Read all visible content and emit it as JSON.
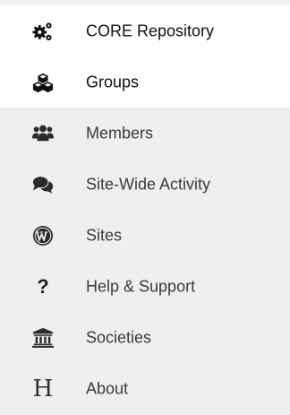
{
  "menu": {
    "items": [
      {
        "label": "CORE Repository",
        "icon": "gears-icon"
      },
      {
        "label": "Groups",
        "icon": "cubes-icon"
      },
      {
        "label": "Members",
        "icon": "users-icon"
      },
      {
        "label": "Site-Wide Activity",
        "icon": "comments-icon"
      },
      {
        "label": "Sites",
        "icon": "wordpress-icon"
      },
      {
        "label": "Help & Support",
        "icon": "question-icon"
      },
      {
        "label": "Societies",
        "icon": "university-icon"
      },
      {
        "label": "About",
        "icon": "h-letter-icon"
      }
    ],
    "help_glyph": "?",
    "about_glyph": "H"
  },
  "colors": {
    "active_background": "#ffffff",
    "inactive_background": "#efefef",
    "icon_color": "#2a2a2a",
    "text_color": "#3a3a3a"
  }
}
